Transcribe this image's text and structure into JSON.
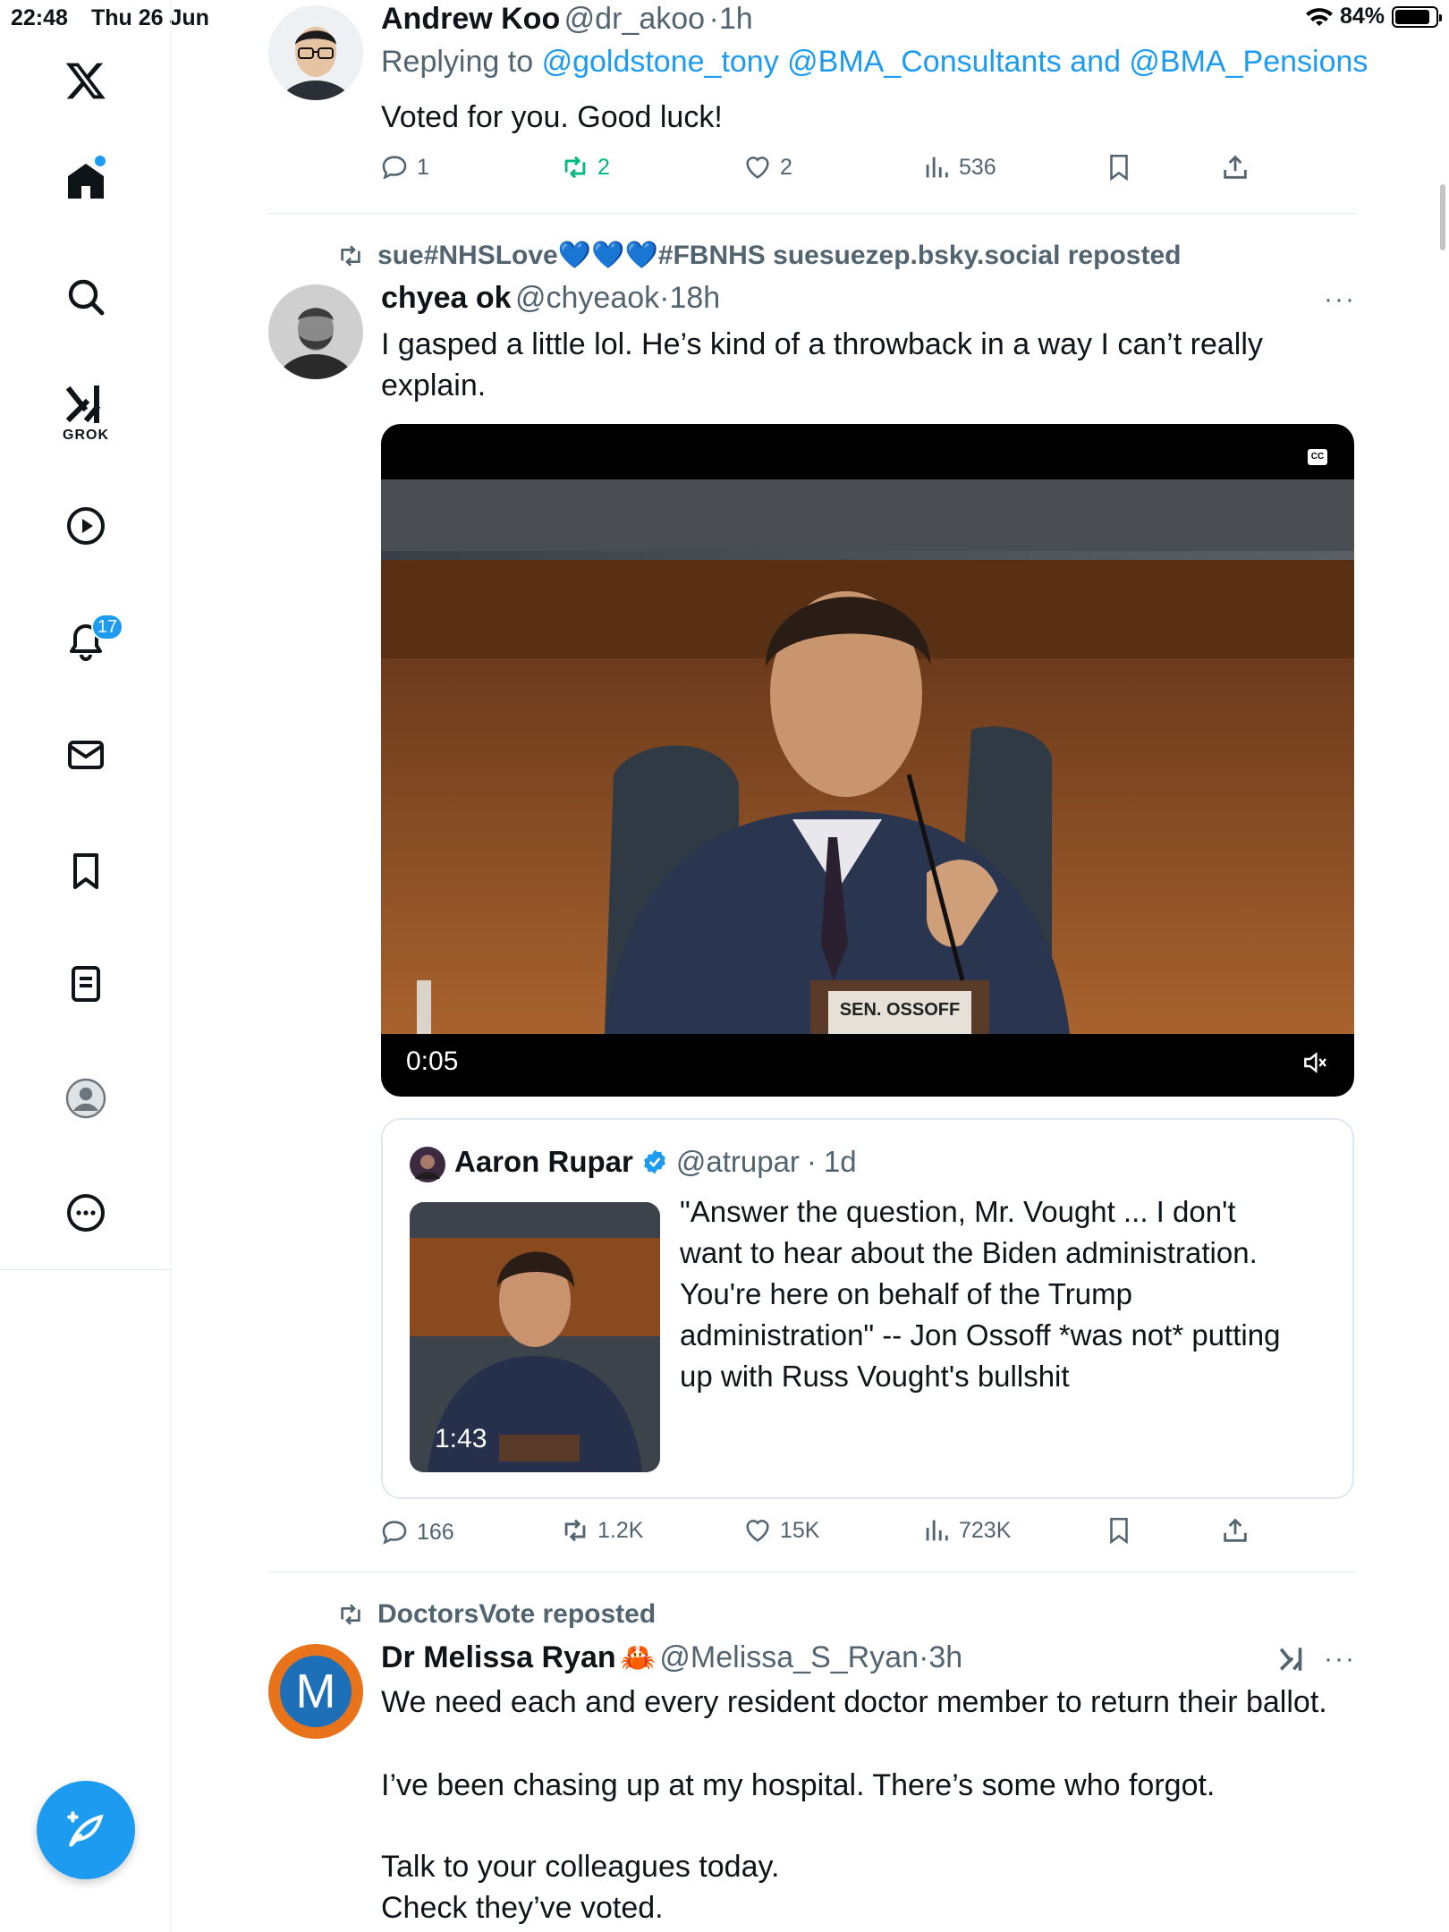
{
  "status_bar": {
    "time": "22:48",
    "date": "Thu 26 Jun",
    "battery": "84%"
  },
  "sidebar": {
    "grok_label": "GROK",
    "notifications_count": "17"
  },
  "posts": [
    {
      "author": "Andrew Koo",
      "handle": "@dr_akoo",
      "age": "1h",
      "replying_prefix": "Replying to",
      "replying_to": "@goldstone_tony @BMA_Consultants and @BMA_Pensions",
      "text": "Voted for you. Good luck!",
      "replies": "1",
      "reposts": "2",
      "likes": "2",
      "views": "536"
    },
    {
      "reposted_by": "sue#NHSLove💙💙💙#FBNHS suesuezep.bsky.social reposted",
      "author": "chyea ok",
      "handle": "@chyeaok",
      "age": "18h",
      "text_line1": "I gasped a little lol. He’s kind of a throwback in a way I can’t really",
      "text_line2": "explain.",
      "video_time": "0:05",
      "video_caption_badge": "CC",
      "video_nameplate": "SEN. OSSOFF",
      "quote": {
        "author": "Aaron Rupar",
        "handle": "@atrupar",
        "age": "1d",
        "lines": [
          "\"Answer the question, Mr. Vought ... I don't",
          "want to hear about the Biden administration.",
          "You're here on behalf of the Trump",
          "administration\" -- Jon Ossoff *was not* putting",
          "up with Russ Vought's bullshit"
        ],
        "thumb_time": "1:43"
      },
      "replies": "166",
      "reposts": "1.2K",
      "likes": "15K",
      "views": "723K"
    },
    {
      "reposted_by": "DoctorsVote reposted",
      "author": "Dr Melissa Ryan",
      "author_emoji": "🦀",
      "handle": "@Melissa_S_Ryan",
      "age": "3h",
      "avatar_letter": "M",
      "lines": [
        "We need each and every resident doctor member to return their ballot.",
        "I’ve been chasing up at my hospital. There’s some who forgot.",
        "Talk to your colleagues today.",
        "Check they’ve voted."
      ]
    }
  ],
  "colors": {
    "accent": "#1d9bf0",
    "text": "#0f1419",
    "muted": "#536471",
    "repost_green": "#00ba7c"
  }
}
